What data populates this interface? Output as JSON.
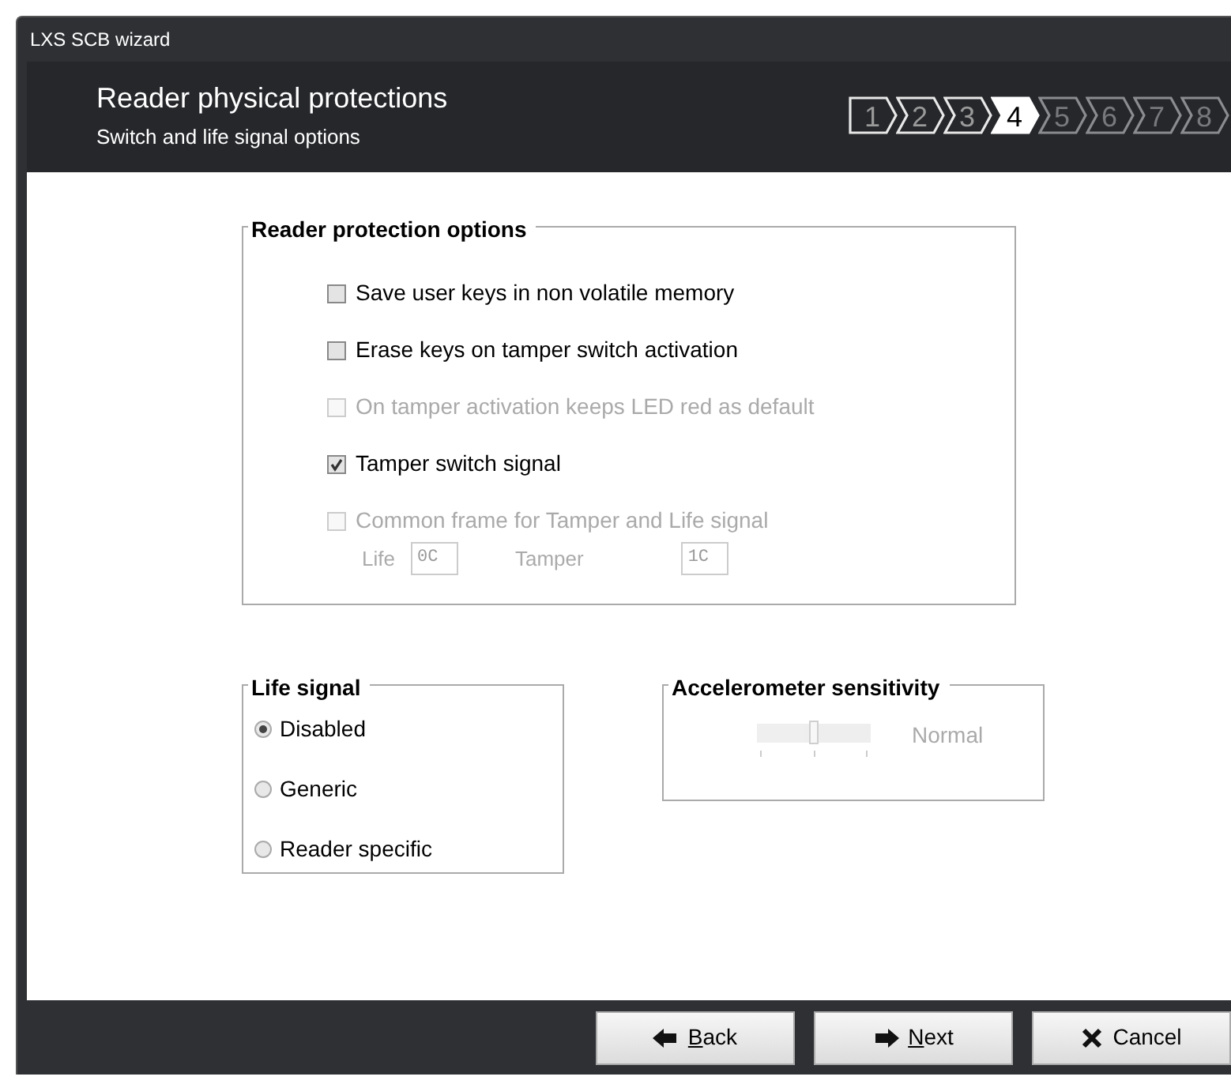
{
  "window": {
    "title": "LXS SCB wizard"
  },
  "header": {
    "title": "Reader physical protections",
    "subtitle": "Switch and life signal options"
  },
  "steps": [
    {
      "label": "1",
      "selected": false,
      "done": true
    },
    {
      "label": "2",
      "selected": false,
      "done": true
    },
    {
      "label": "3",
      "selected": false,
      "done": true
    },
    {
      "label": "4",
      "selected": true,
      "done": false
    },
    {
      "label": "5",
      "selected": false,
      "done": false
    },
    {
      "label": "6",
      "selected": false,
      "done": false
    },
    {
      "label": "7",
      "selected": false,
      "done": false
    },
    {
      "label": "8",
      "selected": false,
      "done": false
    }
  ],
  "protection": {
    "title": "Reader protection options",
    "options": [
      {
        "label": "Save user keys in non volatile memory",
        "checked": false,
        "disabled": false
      },
      {
        "label": "Erase keys on tamper switch activation",
        "checked": false,
        "disabled": false
      },
      {
        "label": "On tamper activation keeps LED red as default",
        "checked": false,
        "disabled": true
      },
      {
        "label": "Tamper switch signal",
        "checked": true,
        "disabled": false
      },
      {
        "label": "Common frame for Tamper and Life signal",
        "checked": false,
        "disabled": true
      }
    ],
    "fields": [
      {
        "label": "Life",
        "value": "0C",
        "disabled": true
      },
      {
        "label": "Tamper",
        "value": "1C",
        "disabled": true
      }
    ]
  },
  "life_signal": {
    "title": "Life signal",
    "options": [
      {
        "label": "Disabled",
        "selected": true
      },
      {
        "label": "Generic",
        "selected": false
      },
      {
        "label": "Reader specific",
        "selected": false
      }
    ]
  },
  "accelerometer": {
    "title": "Accelerometer sensitivity",
    "level": 0.5,
    "disabled": true,
    "reading": "Normal"
  },
  "buttons": [
    {
      "kind": "back",
      "access_key": "B",
      "rest": "ack"
    },
    {
      "kind": "next",
      "access_key": "N",
      "rest": "ext"
    },
    {
      "kind": "cancel",
      "rest": "Cancel"
    }
  ]
}
